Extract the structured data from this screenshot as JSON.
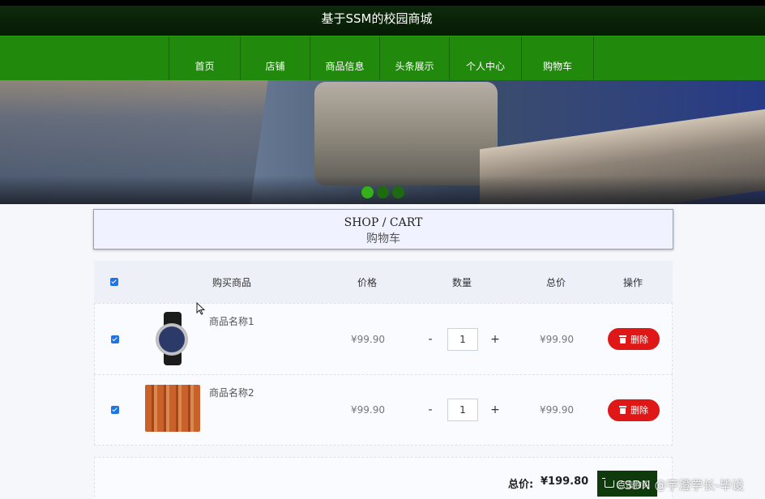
{
  "header": {
    "site_title": "基于SSM的校园商城"
  },
  "nav": {
    "items": [
      {
        "label": "首页"
      },
      {
        "label": "店铺"
      },
      {
        "label": "商品信息"
      },
      {
        "label": "头条展示"
      },
      {
        "label": "个人中心"
      },
      {
        "label": "购物车"
      }
    ]
  },
  "banner": {
    "slide_count": 3,
    "active_slide": 1
  },
  "section": {
    "title_en": "SHOP / CART",
    "title_cn": "购物车"
  },
  "cart": {
    "columns": [
      "购买商品",
      "价格",
      "数量",
      "总价",
      "操作"
    ],
    "select_all_checked": true,
    "items": [
      {
        "name": "商品名称1",
        "price": "¥99.90",
        "quantity": "1",
        "total": "¥99.90",
        "delete_label": "删除",
        "checked": true,
        "thumb_icon": "watch"
      },
      {
        "name": "商品名称2",
        "price": "¥99.90",
        "quantity": "1",
        "total": "¥99.90",
        "delete_label": "删除",
        "checked": true,
        "thumb_icon": "books"
      }
    ],
    "minus_label": "-",
    "plus_label": "+"
  },
  "summary": {
    "total_label": "总价:",
    "total_value": "¥199.80",
    "checkout_label": "点击购买"
  },
  "watermark": "CSDN @宇澄学长-毕设",
  "colors": {
    "nav_green": "#218a0c",
    "delete_red": "#e01717",
    "checkout_dark_green": "#0f3b0c",
    "checkbox_blue": "#1f73e6"
  }
}
